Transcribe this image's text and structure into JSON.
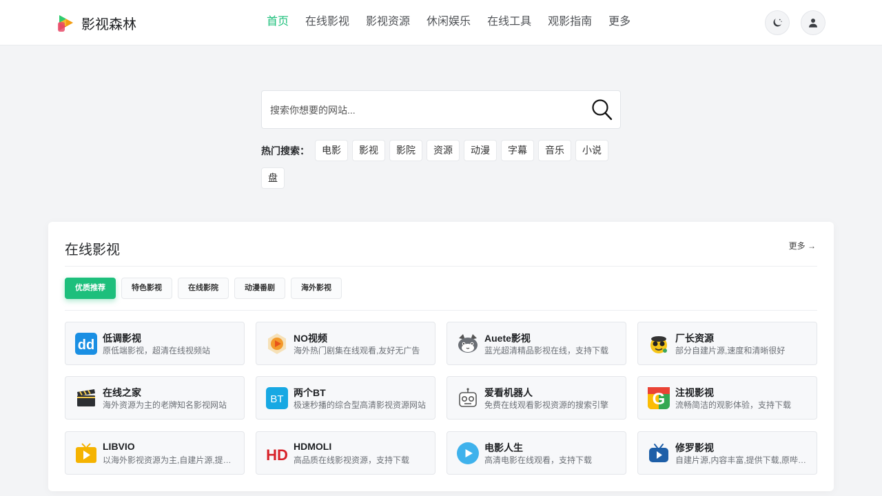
{
  "header": {
    "brand": "影视森林",
    "nav": [
      "首页",
      "在线影视",
      "影视资源",
      "休闲娱乐",
      "在线工具",
      "观影指南",
      "更多"
    ]
  },
  "search": {
    "placeholder": "搜索你想要的网站...",
    "hot_label": "热门搜索：",
    "hot_tags": [
      "电影",
      "影视",
      "影院",
      "资源",
      "动漫",
      "字幕",
      "音乐",
      "小说",
      "盘"
    ]
  },
  "section": {
    "title": "在线影视",
    "more": "更多",
    "tabs": [
      "优质推荐",
      "特色影视",
      "在线影院",
      "动漫番剧",
      "海外影视"
    ],
    "sites": [
      {
        "name": "低调影视",
        "desc": "原低端影视，超清在线视频站",
        "icon": "dd-icon"
      },
      {
        "name": "NO视频",
        "desc": "海外热门剧集在线观看,友好无广告",
        "icon": "play-hexagon-icon"
      },
      {
        "name": "Auete影视",
        "desc": "蓝光超清精品影视在线，支持下载",
        "icon": "cat-icon"
      },
      {
        "name": "厂长资源",
        "desc": "部分自建片源,速度和清晰很好",
        "icon": "mascot-icon"
      },
      {
        "name": "在线之家",
        "desc": "海外资源为主的老牌知名影视网站",
        "icon": "clapperboard-icon"
      },
      {
        "name": "两个BT",
        "desc": "极速秒播的综合型高清影视资源网站",
        "icon": "bt-icon"
      },
      {
        "name": "爱看机器人",
        "desc": "免费在线观看影视资源的搜索引擎",
        "icon": "robot-icon"
      },
      {
        "name": "注视影视",
        "desc": "流畅简洁的观影体验，支持下载",
        "icon": "g-icon"
      },
      {
        "name": "LIBVIO",
        "desc": "以海外影视资源为主,自建片源,提供下载",
        "icon": "tv-play-icon"
      },
      {
        "name": "HDMOLI",
        "desc": "高品质在线影视资源，支持下载",
        "icon": "hd-icon"
      },
      {
        "name": "电影人生",
        "desc": "高清电影在线观看，支持下载",
        "icon": "play-circle-icon"
      },
      {
        "name": "修罗影视",
        "desc": "自建片源,内容丰富,提供下载,原哔嘀影视",
        "icon": "blue-tv-icon"
      }
    ]
  },
  "colors": {
    "accent": "#1bbf7a",
    "background": "#f3f4f6"
  }
}
